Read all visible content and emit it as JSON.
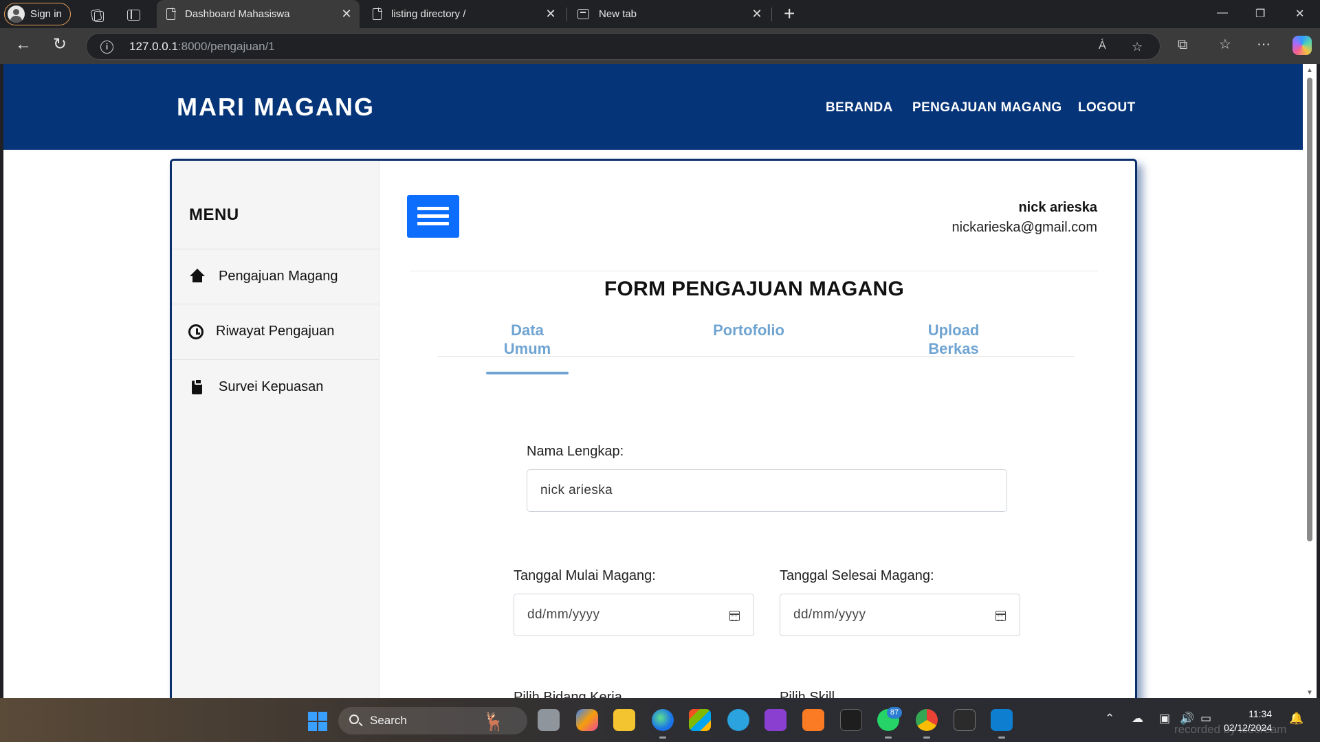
{
  "browser": {
    "signin_label": "Sign in",
    "tabs": [
      {
        "title": "Dashboard Mahasiswa",
        "active": true
      },
      {
        "title": "listing directory /",
        "active": false
      },
      {
        "title": "New tab",
        "active": false
      }
    ],
    "url_host": "127.0.0.1",
    "url_path": ":8000/pengajuan/1"
  },
  "navbar": {
    "brand": "MARI MAGANG",
    "links": [
      "BERANDA",
      "PENGAJUAN MAGANG",
      "LOGOUT"
    ],
    "bg_color": "#063478"
  },
  "sidebar": {
    "title": "MENU",
    "items": [
      {
        "label": "Pengajuan Magang",
        "icon": "home-icon"
      },
      {
        "label": "Riwayat Pengajuan",
        "icon": "history-icon"
      },
      {
        "label": "Survei Kepuasan",
        "icon": "clipboard-icon"
      }
    ]
  },
  "user": {
    "name": "nick arieska",
    "email": "nickarieska@gmail.com"
  },
  "form": {
    "title": "FORM PENGAJUAN MAGANG",
    "tabs": [
      {
        "line1": "Data",
        "line2": "Umum",
        "active": true
      },
      {
        "line1": "Portofolio",
        "line2": "",
        "active": false
      },
      {
        "line1": "Upload",
        "line2": "Berkas",
        "active": false
      }
    ],
    "nama_label": "Nama Lengkap:",
    "nama_value": "nick arieska",
    "mulai_label": "Tanggal Mulai Magang:",
    "mulai_placeholder": "dd/mm/yyyy",
    "selesai_label": "Tanggal Selesai Magang:",
    "selesai_placeholder": "dd/mm/yyyy",
    "bidang_label_partial": "Pilih Bidang Kerja",
    "skill_label_partial": "Pilih Skill",
    "accent_color": "#0d6efd",
    "tab_color": "#6fa4d2"
  },
  "taskbar": {
    "search_label": "Search",
    "whatsapp_badge": "87",
    "time": "11:34",
    "date": "02/12/2024",
    "watermark": "recorded by icecream"
  }
}
